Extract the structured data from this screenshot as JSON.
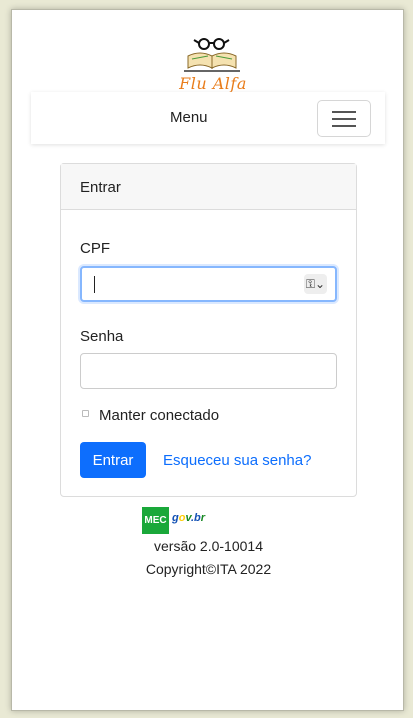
{
  "logo": {
    "text": "Flu Alfa"
  },
  "navbar": {
    "menu_label": "Menu"
  },
  "login_card": {
    "header": "Entrar",
    "cpf_label": "CPF",
    "cpf_value": "",
    "senha_label": "Senha",
    "senha_value": "",
    "remember_label": "Manter conectado",
    "submit_label": "Entrar",
    "forgot_link": "Esqueceu sua senha?"
  },
  "footer": {
    "mec_logo_text": "MEC",
    "govbr_logo_text": "gov.br",
    "version": "versão 2.0-10014",
    "copyright": "Copyright©ITA 2022"
  },
  "colors": {
    "primary": "#0d6efd",
    "logo_orange": "#e97d1b",
    "mec_green": "#1aa83a"
  }
}
